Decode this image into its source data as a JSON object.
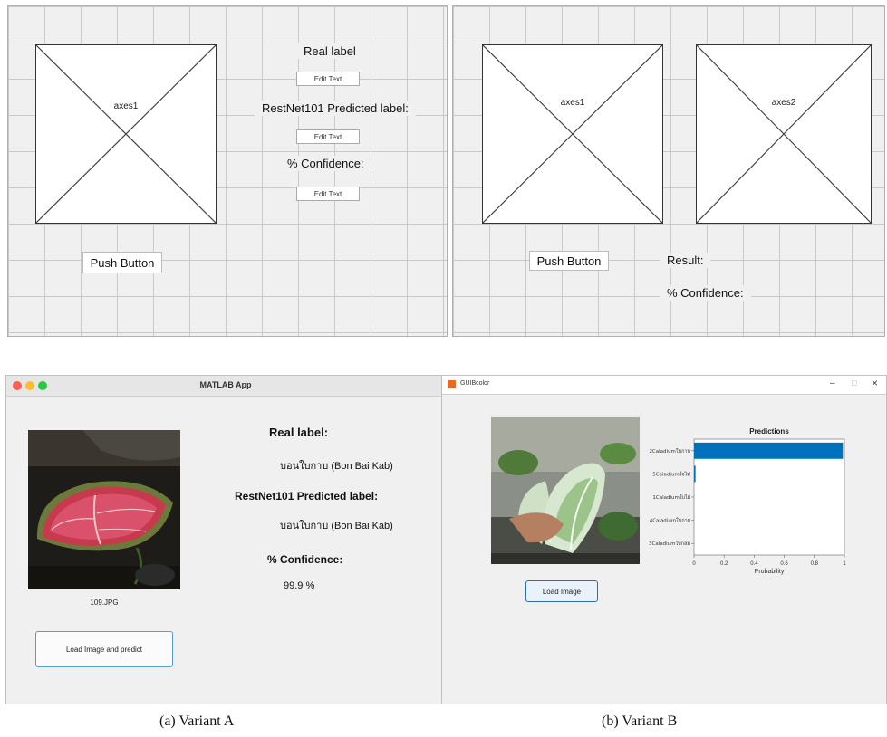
{
  "guide_a": {
    "axes_label": "axes1",
    "real_label": "Real label",
    "edit_text_1": "Edit Text",
    "predicted_label": "RestNet101  Predicted label:",
    "edit_text_2": "Edit Text",
    "confidence_label": "% Confidence:",
    "edit_text_3": "Edit Text",
    "push_button": "Push Button"
  },
  "guide_b": {
    "axes1_label": "axes1",
    "axes2_label": "axes2",
    "push_button": "Push Button",
    "result_label": "Result:",
    "confidence_label": "% Confidence:"
  },
  "app_a": {
    "window_title": "MATLAB App",
    "image_filename": "109.JPG",
    "real_label_heading": "Real label:",
    "real_label_value": "บอนใบกาบ (Bon Bai Kab)",
    "predicted_heading": "RestNet101 Predicted label:",
    "predicted_value": "บอนใบกาบ (Bon Bai Kab)",
    "confidence_heading": "% Confidence:",
    "confidence_value": "99.9 %",
    "load_button": "Load Image and predict"
  },
  "app_b": {
    "window_title": "GUIBcolor",
    "load_button": "Load Image",
    "min_glyph": "–",
    "max_glyph": "□",
    "close_glyph": "×"
  },
  "chart_data": {
    "type": "bar",
    "orientation": "horizontal",
    "title": "Predictions",
    "xlabel": "Probability",
    "ylabel": "",
    "xlim": [
      0,
      1
    ],
    "xticks": [
      "0",
      "0.2",
      "0.4",
      "0.6",
      "0.8",
      "1"
    ],
    "categories": [
      "2Caladiumใบกาบ",
      "5Caladiumใจไม่",
      "1Caladiumใบไผ่",
      "4Caladiumใบกาย",
      "3Caladiumใบกลม"
    ],
    "values": [
      0.99,
      0.01,
      0.0,
      0.0,
      0.0
    ],
    "bar_color": "#0072bd",
    "grid": false
  },
  "captions": {
    "a": "(a) Variant A",
    "b": "(b) Variant B"
  }
}
